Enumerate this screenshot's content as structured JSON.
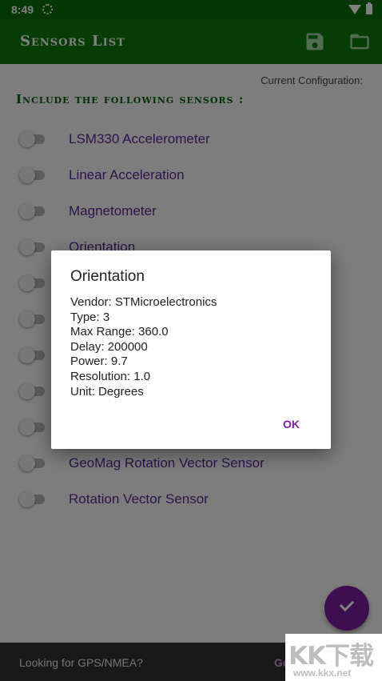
{
  "status_bar": {
    "time": "8:49"
  },
  "app_bar": {
    "title": "Sensors List"
  },
  "content": {
    "current_configuration_label": "Current Configuration:",
    "include_heading": "Include the following sensors :",
    "sensors": [
      {
        "label": "LSM330 Accelerometer",
        "enabled": false
      },
      {
        "label": "Linear Acceleration",
        "enabled": false
      },
      {
        "label": "Magnetometer",
        "enabled": false
      },
      {
        "label": "Orientation",
        "enabled": false
      },
      {
        "label": "",
        "enabled": false
      },
      {
        "label": "",
        "enabled": false
      },
      {
        "label": "",
        "enabled": false
      },
      {
        "label": "",
        "enabled": false
      },
      {
        "label": "",
        "enabled": false
      },
      {
        "label": "GeoMag Rotation Vector Sensor",
        "enabled": false
      },
      {
        "label": "Rotation Vector Sensor",
        "enabled": false
      }
    ]
  },
  "dialog": {
    "title": "Orientation",
    "lines": [
      "Vendor: STMicroelectronics",
      "Type: 3",
      "Max Range: 360.0",
      "Delay: 200000",
      "Power: 9.7",
      "Resolution: 1.0",
      "Unit: Degrees"
    ],
    "ok_label": "OK"
  },
  "snackbar": {
    "text": "Looking for GPS/NMEA?",
    "action": "Go"
  },
  "watermark": {
    "text": "KK下载",
    "url": "www.kkx.net"
  },
  "colors": {
    "app_bar": "#0b7a0b",
    "status_bar": "#0b6f0b",
    "heading": "#0b5e0b",
    "sensor_label": "#5a2a96",
    "accent": "#7b1fa2"
  }
}
